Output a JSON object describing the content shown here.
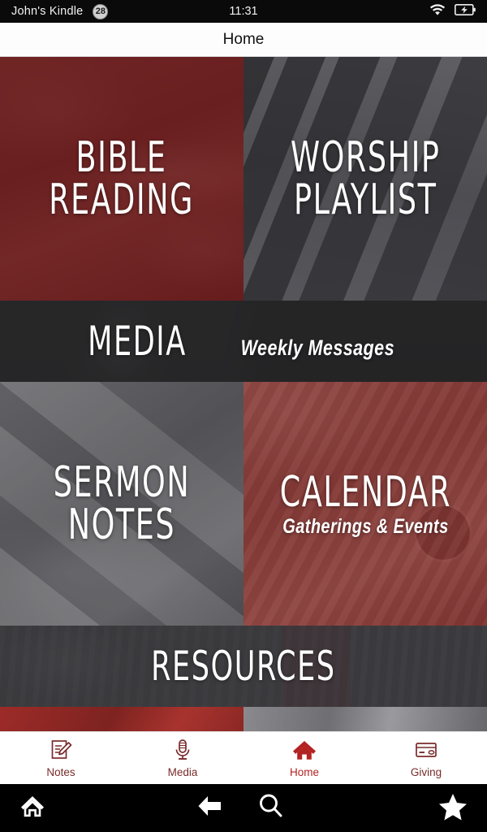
{
  "status_bar": {
    "device_name": "John's Kindle",
    "notification_count": "28",
    "time": "11:31",
    "wifi_icon": "wifi-icon",
    "battery_icon": "battery-charging-icon"
  },
  "header": {
    "title": "Home"
  },
  "colors": {
    "brand_red": "#7a1f22",
    "accent_red": "#b32222",
    "tile_red": "#701618",
    "tile_red_light": "#8c2d2b",
    "tile_gray": "#3e3e42",
    "banner_dark": "#242426",
    "tab_inactive": "#7a2b2b",
    "status_bar": "#0a0a0a"
  },
  "tiles": [
    {
      "name": "bible-reading",
      "title": "BIBLE READING",
      "line1": "BIBLE",
      "line2": "READING",
      "subtitle": "",
      "theme": "red",
      "photo": "hands-writing-in-journal"
    },
    {
      "name": "worship-playlist",
      "title": "WORSHIP PLAYLIST",
      "line1": "WORSHIP",
      "line2": "PLAYLIST",
      "subtitle": "",
      "theme": "gray",
      "photo": "piano-keys"
    },
    {
      "name": "media",
      "title": "MEDIA",
      "subtitle": "Weekly Messages",
      "theme": "dark",
      "photo": "vintage-microphone-headphones"
    },
    {
      "name": "sermon-notes",
      "title": "SERMON NOTES",
      "line1": "SERMON",
      "line2": "NOTES",
      "subtitle": "",
      "theme": "gray",
      "photo": "open-bible-and-pen"
    },
    {
      "name": "calendar",
      "title": "CALENDAR",
      "subtitle": "Gatherings & Events",
      "theme": "red-light",
      "photo": "desk-laptop-calendar-coffee"
    },
    {
      "name": "resources",
      "title": "RESOURCES",
      "subtitle": "",
      "theme": "dark",
      "photo": "desk-supplies"
    }
  ],
  "tab_bar": {
    "items": [
      {
        "label": "Notes",
        "icon": "notes-pencil-icon",
        "active": false
      },
      {
        "label": "Media",
        "icon": "microphone-icon",
        "active": false
      },
      {
        "label": "Home",
        "icon": "home-icon",
        "active": true
      },
      {
        "label": "Giving",
        "icon": "credit-card-icon",
        "active": false
      }
    ]
  },
  "nav_bar": {
    "buttons": [
      {
        "label": "Home",
        "icon": "home-outline-icon"
      },
      {
        "label": "Back",
        "icon": "back-arrow-icon"
      },
      {
        "label": "Search",
        "icon": "search-icon"
      },
      {
        "label": "Favorites",
        "icon": "star-icon"
      }
    ]
  }
}
